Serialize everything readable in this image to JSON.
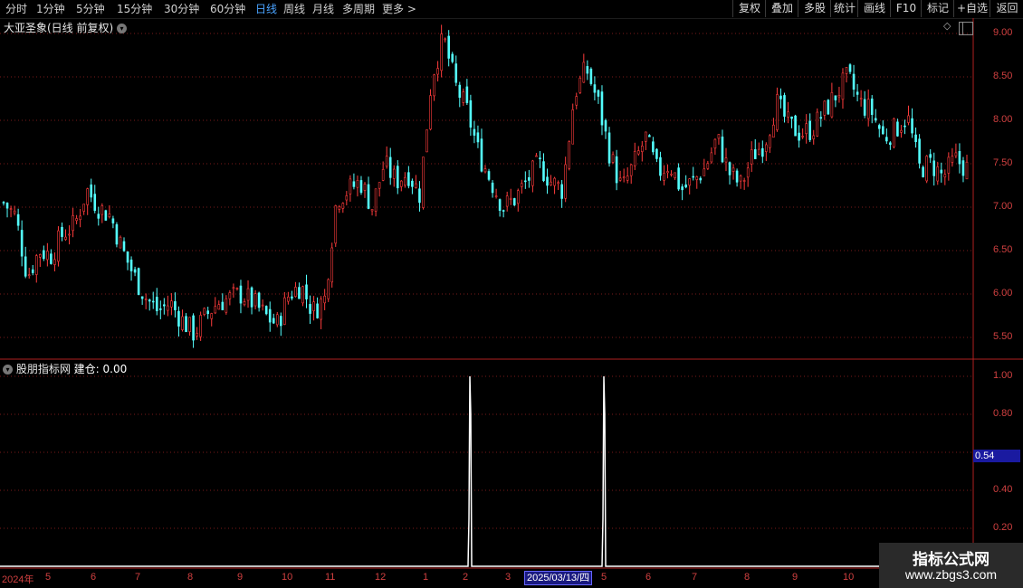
{
  "toolbar": {
    "timeframes": [
      "分时",
      "1分钟",
      "5分钟",
      "15分钟",
      "30分钟",
      "60分钟",
      "日线",
      "周线",
      "月线",
      "多周期",
      "更多 >"
    ],
    "active_timeframe": "日线",
    "right_buttons": [
      "复权",
      "叠加",
      "多股",
      "统计",
      "画线",
      "F10",
      "标记",
      "+自选",
      "返回"
    ]
  },
  "main_chart": {
    "title": "大亚圣象(日线 前复权)",
    "y_ticks": [
      "9.00",
      "8.50",
      "8.00",
      "7.50",
      "7.00",
      "6.50",
      "6.00",
      "5.50"
    ]
  },
  "indicator": {
    "name": "股朋指标网",
    "line_label": "建仓: 0.00",
    "y_ticks": [
      "1.00",
      "0.80",
      "0.40",
      "0.20"
    ],
    "marker_value": "0.54"
  },
  "x_axis": {
    "labels": [
      "2024年",
      "5",
      "6",
      "7",
      "8",
      "9",
      "10",
      "11",
      "12",
      "1",
      "2",
      "3",
      "5",
      "6",
      "7",
      "8",
      "9",
      "10"
    ],
    "cursor_date": "2025/03/13/四"
  },
  "watermark": {
    "title": "指标公式网",
    "url": "www.zbgs3.com"
  },
  "colors": {
    "up": "#ff3c3c",
    "down": "#54ffff",
    "grid": "#7a1a1a",
    "axis": "#b02020",
    "active": "#4aa3ff"
  },
  "chart_data": [
    {
      "type": "candlestick",
      "title": "大亚圣象(日线 前复权)",
      "ylim": [
        5.35,
        9.1
      ],
      "x_labels": [
        "2024年",
        "5",
        "6",
        "7",
        "8",
        "9",
        "10",
        "11",
        "12",
        "1",
        "2",
        "3",
        "5",
        "6",
        "7",
        "8",
        "9",
        "10"
      ],
      "series": [
        {
          "name": "close_path",
          "values": [
            7.05,
            6.9,
            6.2,
            6.5,
            6.45,
            6.7,
            6.8,
            7.2,
            7.0,
            6.9,
            6.5,
            6.2,
            5.95,
            5.8,
            5.9,
            5.7,
            5.55,
            5.75,
            5.9,
            5.95,
            6.0,
            5.9,
            5.75,
            5.65,
            6.0,
            6.1,
            5.8,
            5.95,
            7.1,
            7.2,
            7.3,
            7.0,
            7.5,
            7.3,
            7.4,
            7.15,
            8.5,
            8.95,
            8.4,
            8.1,
            7.6,
            7.3,
            7.0,
            7.1,
            7.3,
            7.5,
            7.3,
            7.2,
            8.3,
            8.6,
            8.2,
            7.6,
            7.2,
            7.5,
            7.8,
            7.4,
            7.5,
            7.2,
            7.3,
            7.45,
            7.8,
            7.4,
            7.25,
            7.6,
            7.75,
            8.2,
            7.95,
            7.85,
            7.9,
            8.1,
            8.3,
            8.5,
            8.2,
            8.1,
            7.8,
            7.9,
            8.05,
            7.45,
            7.5,
            7.35,
            7.55,
            7.45
          ]
        }
      ]
    },
    {
      "type": "line",
      "title": "股朋指标网",
      "ylim": [
        0,
        1.0
      ],
      "series": [
        {
          "name": "建仓",
          "spikes_at": [
            "2025-02",
            "2025-04"
          ],
          "values": [
            1.0,
            1.0
          ]
        }
      ]
    }
  ]
}
